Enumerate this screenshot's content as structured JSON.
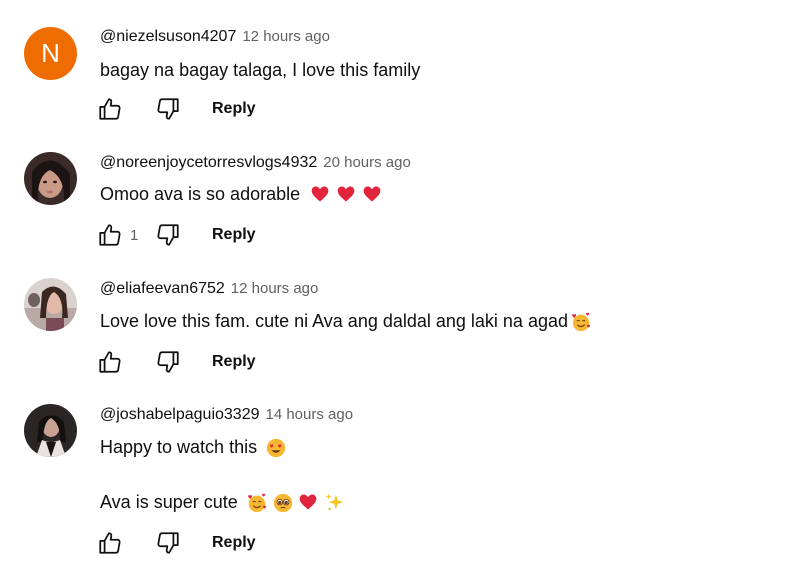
{
  "comments": [
    {
      "handle": "@niezelsuson4207",
      "time": "12 hours ago",
      "avatar_letter": "N",
      "text": "bagay na bagay talaga, I love this family",
      "like_count": "",
      "reply_label": "Reply"
    },
    {
      "handle": "@noreenjoycetorresvlogs4932",
      "time": "20 hours ago",
      "text": "Omoo ava is so adorable",
      "emojis": [
        "red-heart",
        "red-heart",
        "red-heart"
      ],
      "like_count": "1",
      "reply_label": "Reply"
    },
    {
      "handle": "@eliafeevan6752",
      "time": "12 hours ago",
      "text": "Love love this fam. cute ni Ava ang daldal ang laki na agad",
      "emojis": [
        "smiling-face-with-hearts"
      ],
      "like_count": "",
      "reply_label": "Reply"
    },
    {
      "handle": "@joshabelpaguio3329",
      "time": "14 hours ago",
      "text_line1": "Happy to watch this",
      "text_line2": "Ava is super cute",
      "emojis_line1": [
        "heart-eyes"
      ],
      "emojis_line2": [
        "smiling-face-with-hearts",
        "pleading-face",
        "red-heart",
        "sparkles"
      ],
      "like_count": "",
      "reply_label": "Reply"
    }
  ],
  "colors": {
    "avatar_orange": "#ef6c00",
    "heart_red": "#e0243c",
    "meta_gray": "#606060",
    "text_dark": "#0f0f0f"
  },
  "icons": {
    "like": "thumbs-up-outline-icon",
    "dislike": "thumbs-down-outline-icon"
  }
}
